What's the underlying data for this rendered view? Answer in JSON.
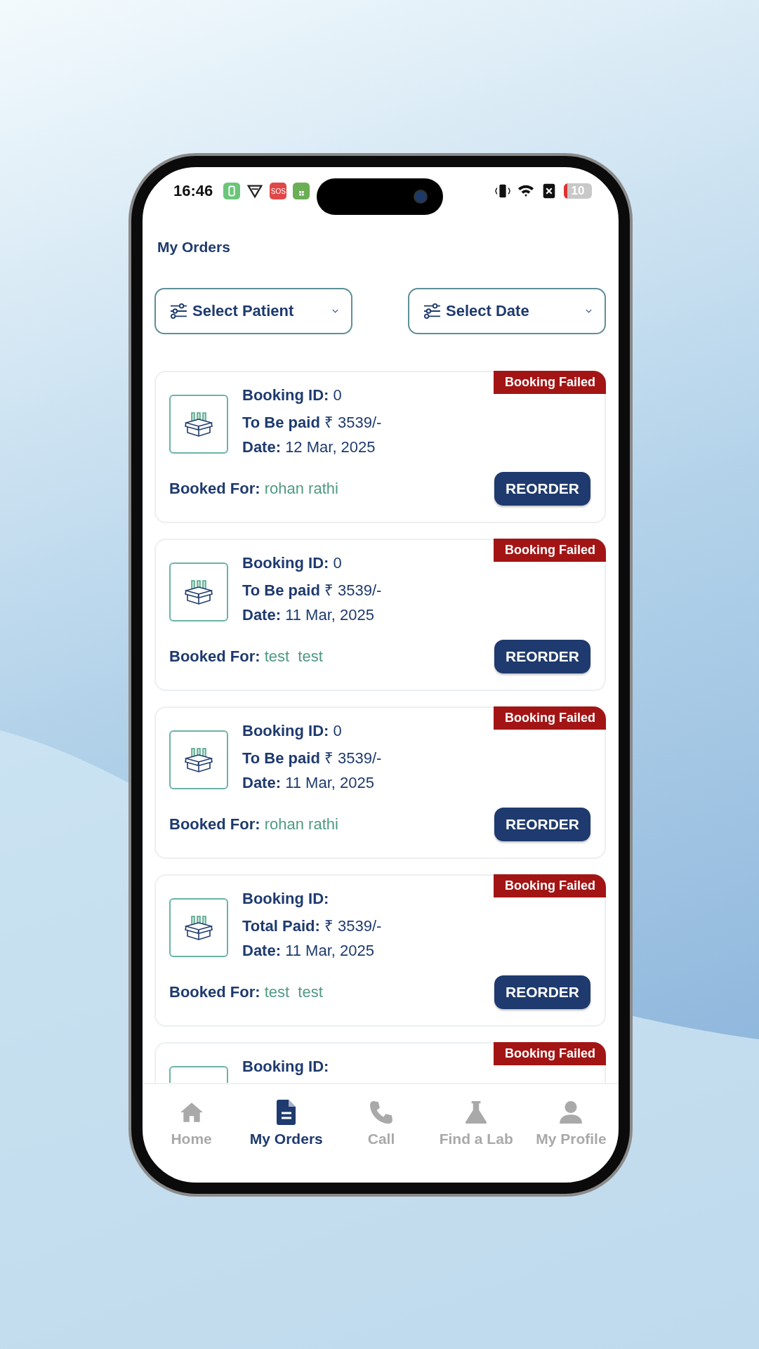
{
  "status_bar": {
    "time": "16:46",
    "sos_label": "SOS",
    "battery": "10"
  },
  "header": {
    "title": "My Orders"
  },
  "filters": [
    {
      "label": "Select Patient"
    },
    {
      "label": "Select Date"
    }
  ],
  "orders": [
    {
      "status": "Booking Failed",
      "id_label": "Booking ID:",
      "id": "0",
      "amount_label": "To Be paid",
      "amount": "₹ 3539/-",
      "date_label": "Date:",
      "date": "12 Mar, 2025",
      "booked_for_label": "Booked For:",
      "booked_for": "rohan rathi",
      "button": "REORDER"
    },
    {
      "status": "Booking Failed",
      "id_label": "Booking ID:",
      "id": "0",
      "amount_label": "To Be paid",
      "amount": "₹ 3539/-",
      "date_label": "Date:",
      "date": "11 Mar, 2025",
      "booked_for_label": "Booked For:",
      "booked_for": "test  test",
      "button": "REORDER"
    },
    {
      "status": "Booking Failed",
      "id_label": "Booking ID:",
      "id": "0",
      "amount_label": "To Be paid",
      "amount": "₹ 3539/-",
      "date_label": "Date:",
      "date": "11 Mar, 2025",
      "booked_for_label": "Booked For:",
      "booked_for": "rohan rathi",
      "button": "REORDER"
    },
    {
      "status": "Booking Failed",
      "id_label": "Booking ID:",
      "amount_label": "Total Paid:",
      "amount": "₹ 3539/-",
      "date_label": "Date:",
      "date": "11 Mar, 2025",
      "booked_for_label": "Booked For:",
      "booked_for": "test  test",
      "button": "REORDER"
    },
    {
      "status": "Booking Failed",
      "id_label": "Booking ID:"
    }
  ],
  "nav": [
    {
      "kind": "home",
      "label": "Home",
      "selected": false
    },
    {
      "kind": "orders",
      "label": "My Orders",
      "selected": true
    },
    {
      "kind": "call",
      "label": "Call",
      "selected": false
    },
    {
      "kind": "lab",
      "label": "Find a Lab",
      "selected": false
    },
    {
      "kind": "profile",
      "label": "My Profile",
      "selected": false
    }
  ]
}
